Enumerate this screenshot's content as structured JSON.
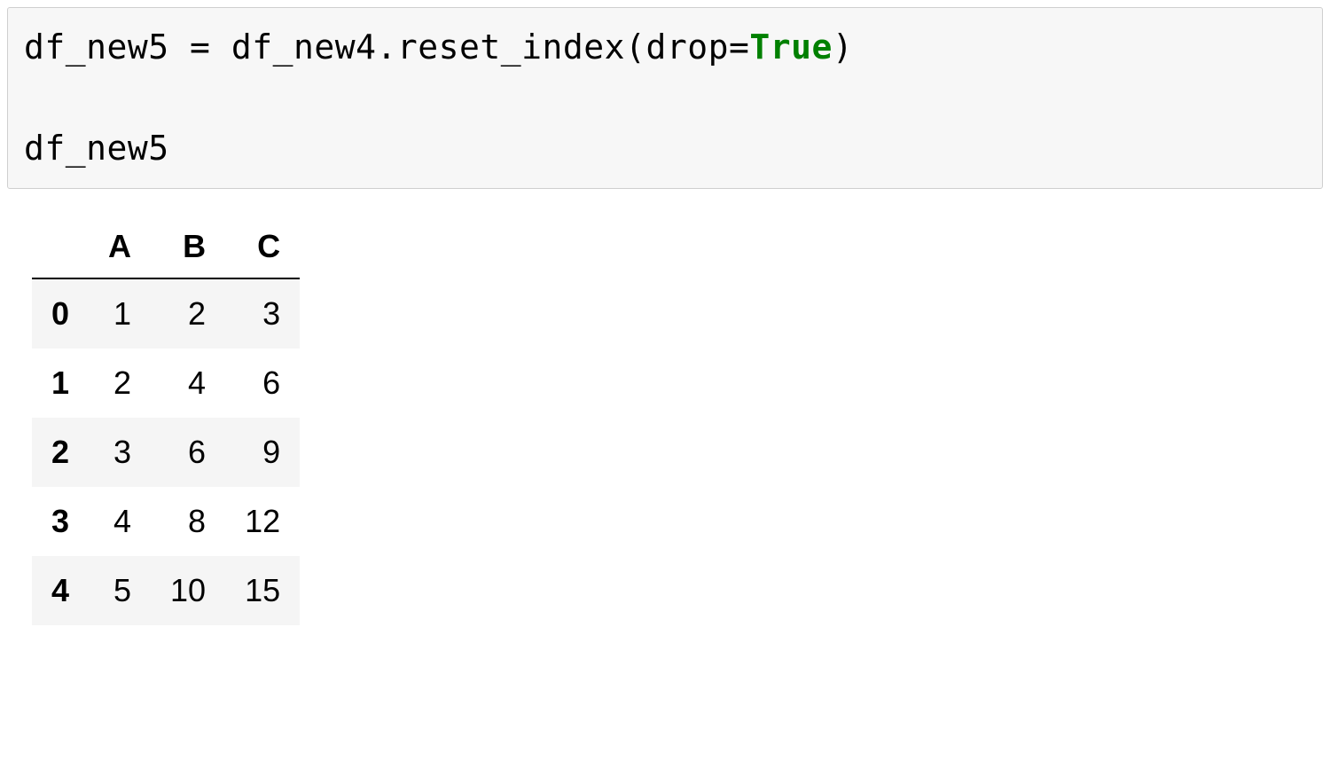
{
  "code": {
    "var_target": "df_new5",
    "space1": " ",
    "assign": "=",
    "space2": " ",
    "var_source": "df_new4",
    "dot": ".",
    "method": "reset_index",
    "paren_open": "(",
    "kwarg": "drop",
    "equals": "=",
    "kwval": "True",
    "paren_close": ")",
    "line2": "df_new5"
  },
  "table": {
    "columns": [
      "A",
      "B",
      "C"
    ],
    "index": [
      "0",
      "1",
      "2",
      "3",
      "4"
    ],
    "rows": [
      [
        "1",
        "2",
        "3"
      ],
      [
        "2",
        "4",
        "6"
      ],
      [
        "3",
        "6",
        "9"
      ],
      [
        "4",
        "8",
        "12"
      ],
      [
        "5",
        "10",
        "15"
      ]
    ]
  }
}
